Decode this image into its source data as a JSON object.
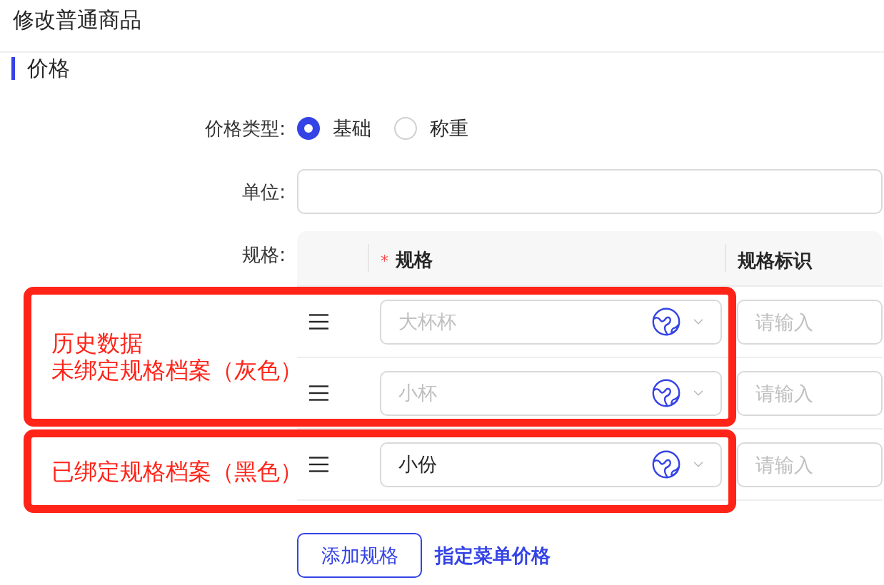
{
  "page": {
    "title": "修改普通商品"
  },
  "section": {
    "title": "价格"
  },
  "price_type": {
    "label": "价格类型:",
    "options": [
      {
        "label": "基础",
        "selected": true
      },
      {
        "label": "称重",
        "selected": false
      }
    ]
  },
  "unit": {
    "label": "单位:"
  },
  "specs": {
    "label": "规格:",
    "columns": [
      {
        "label": "规格",
        "marker": "*"
      },
      {
        "label": "规格标识"
      }
    ],
    "groups": [
      {
        "note": [
          "历史数据",
          "未绑定规格档案（灰色）"
        ],
        "rows": [
          {
            "spec": "大杯杯",
            "bound": false,
            "identifier_placeholder": "请输入"
          },
          {
            "spec": "小杯",
            "bound": false,
            "identifier_placeholder": "请输入"
          }
        ]
      },
      {
        "note": [
          "已绑定规格档案（黑色）"
        ],
        "rows": [
          {
            "spec": "小份",
            "bound": true,
            "identifier_placeholder": "请输入"
          }
        ]
      }
    ]
  },
  "actions": {
    "add_button": "添加规格",
    "menu_price_link": "指定菜单价格"
  }
}
